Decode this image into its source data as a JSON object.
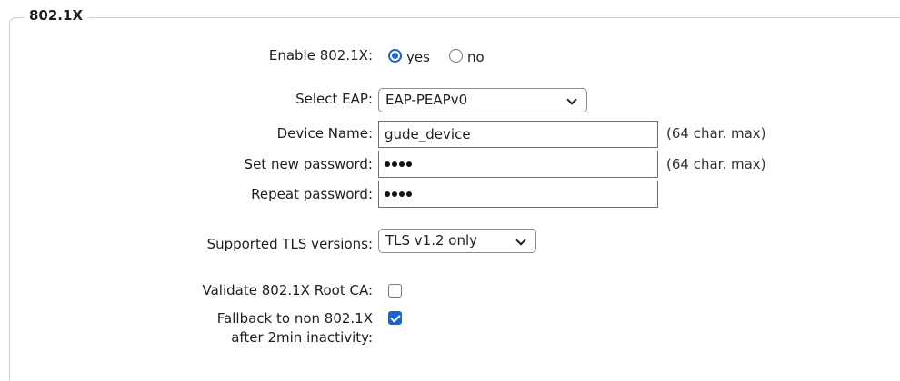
{
  "section": {
    "title": "802.1X"
  },
  "enable": {
    "label": "Enable 802.1X:",
    "yes_label": "yes",
    "no_label": "no",
    "selected": "yes"
  },
  "eap": {
    "label": "Select EAP:",
    "value": "EAP-PEAPv0"
  },
  "device_name": {
    "label": "Device Name:",
    "value": "gude_device",
    "hint": "(64 char. max)"
  },
  "new_password": {
    "label": "Set new password:",
    "masked_length": 4,
    "hint": "(64 char. max)"
  },
  "repeat_password": {
    "label": "Repeat password:",
    "masked_length": 4
  },
  "tls": {
    "label": "Supported TLS versions:",
    "value": "TLS v1.2 only"
  },
  "validate_root_ca": {
    "label": "Validate 802.1X Root CA:",
    "checked": false
  },
  "fallback": {
    "label_line1": "Fallback to non 802.1X",
    "label_line2": "after 2min inactivity:",
    "checked": true
  },
  "colors": {
    "accent": "#1565d8"
  }
}
